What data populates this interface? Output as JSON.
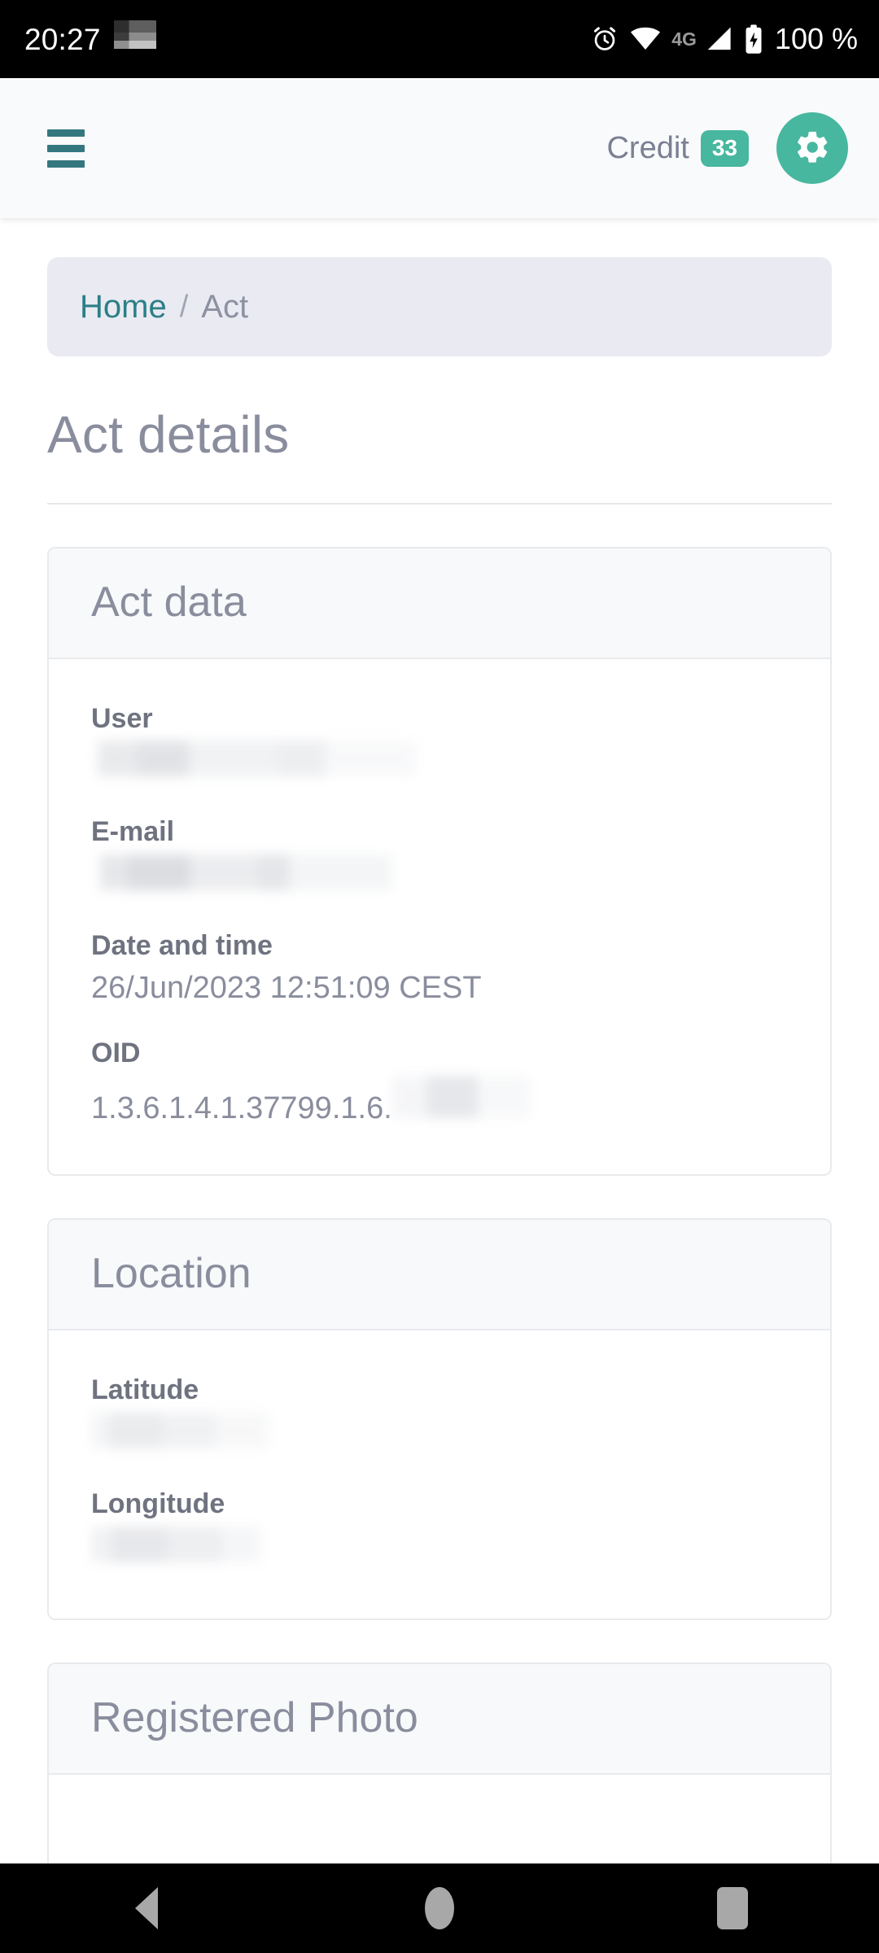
{
  "status_bar": {
    "time": "20:27",
    "network_type": "4G",
    "battery_text": "100 %",
    "icons": [
      "alarm-icon",
      "wifi-icon",
      "signal-icon",
      "battery-charging-icon"
    ]
  },
  "header": {
    "menu_icon": "hamburger-menu-icon",
    "credit_label": "Credit",
    "credit_value": "33",
    "settings_icon": "gear-icon",
    "accent_color": "#48b79f",
    "menu_color": "#35777f"
  },
  "breadcrumb": {
    "home": "Home",
    "separator": "/",
    "current": "Act",
    "link_color": "#2b7f86"
  },
  "page": {
    "title": "Act details"
  },
  "cards": [
    {
      "title": "Act data",
      "fields": [
        {
          "label": "User",
          "value": "",
          "redacted": true
        },
        {
          "label": "E-mail",
          "value": "",
          "redacted": true
        },
        {
          "label": "Date and time",
          "value": "26/Jun/2023 12:51:09 CEST",
          "redacted": false
        },
        {
          "label": "OID",
          "value": "1.3.6.1.4.1.37799.1.6.",
          "redacted": true
        }
      ]
    },
    {
      "title": "Location",
      "fields": [
        {
          "label": "Latitude",
          "value": "",
          "redacted": true
        },
        {
          "label": "Longitude",
          "value": "",
          "redacted": true
        }
      ]
    },
    {
      "title": "Registered Photo",
      "fields": []
    }
  ],
  "nav_bar": {
    "back": "back-button",
    "home": "home-button",
    "recents": "recents-button"
  }
}
